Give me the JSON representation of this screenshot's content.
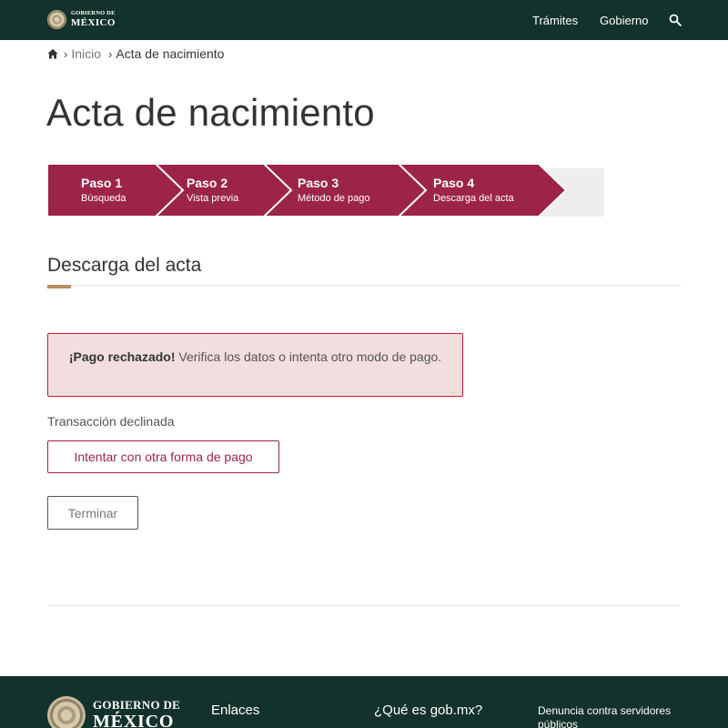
{
  "header": {
    "logo_line1": "GOBIERNO DE",
    "logo_line2": "MÉXICO",
    "nav": [
      "Trámites",
      "Gobierno"
    ],
    "search_icon": "search-icon"
  },
  "breadcrumb": {
    "home_icon": "home-icon",
    "items": [
      "Inicio",
      "Acta de nacimiento"
    ]
  },
  "page": {
    "title": "Acta de nacimiento"
  },
  "stepper": {
    "steps": [
      {
        "title": "Paso 1",
        "subtitle": "Búsqueda"
      },
      {
        "title": "Paso 2",
        "subtitle": "Vista previa"
      },
      {
        "title": "Paso 3",
        "subtitle": "Método de pago"
      },
      {
        "title": "Paso 4",
        "subtitle": "Descarga del acta"
      }
    ]
  },
  "section": {
    "title": "Descarga del acta"
  },
  "alert": {
    "strong": "¡Pago rechazado!",
    "message": " Verifica los datos o intenta otro modo de pago."
  },
  "status": "Transacción declinada",
  "buttons": {
    "retry": "Intentar con otra forma de pago",
    "finish": "Terminar"
  },
  "footer": {
    "logo_line1": "GOBIERNO DE",
    "logo_line2": "MÉXICO",
    "col1": "Enlaces",
    "col2": "¿Qué es gob.mx?",
    "col3": "Denuncia contra servidores públicos"
  },
  "colors": {
    "header_bg": "#13322b",
    "step_active": "#9d2449",
    "step_track": "#eeeeee",
    "accent_gold": "#b38e5d",
    "alert_bg": "#f2dede",
    "alert_border": "#c9202c"
  }
}
